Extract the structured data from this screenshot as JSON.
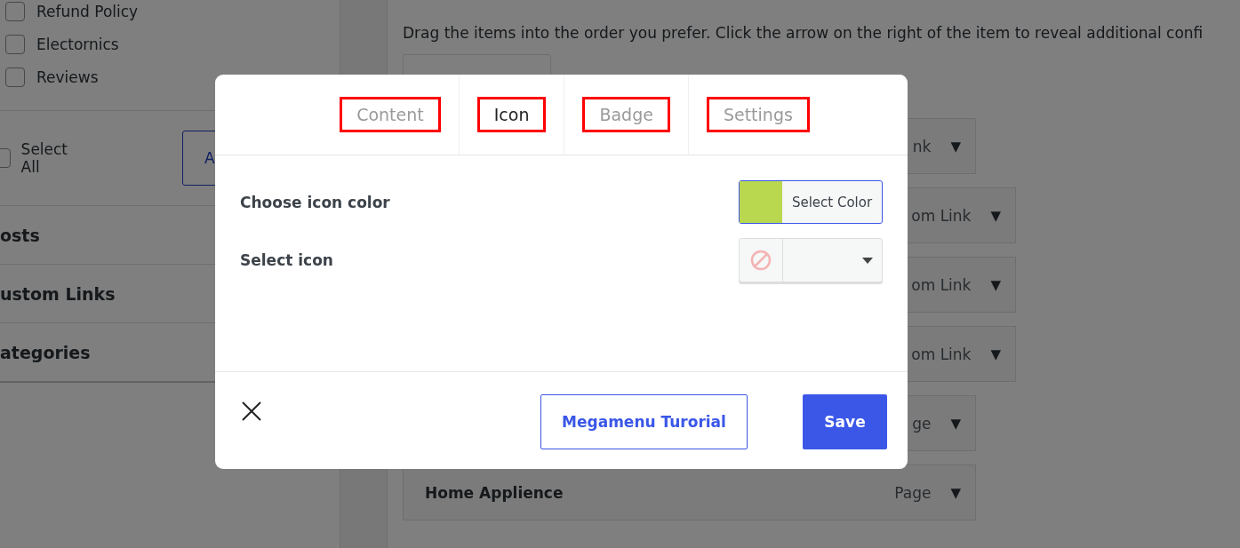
{
  "sidebar": {
    "checkboxes": [
      {
        "label": "Refund Policy",
        "checked": false
      },
      {
        "label": "Electornics",
        "checked": false
      },
      {
        "label": "Reviews",
        "checked": false
      }
    ],
    "select_all": {
      "label": "Select All",
      "checked": false
    },
    "add_button": "A",
    "sections": [
      "osts",
      "ustom Links",
      "ategories"
    ]
  },
  "menu": {
    "instructions": "Drag the items into the order you prefer. Click the arrow on the right of the item to reveal additional confi",
    "items": [
      {
        "type": "nk",
        "arrow": "▼",
        "children": [
          {
            "type": "om Link",
            "arrow": "▼"
          },
          {
            "type": "om Link",
            "arrow": "▼"
          },
          {
            "type": "om Link",
            "arrow": "▼"
          }
        ]
      },
      {
        "type": "ge",
        "arrow": "▼"
      },
      {
        "label": "Home Applience",
        "type": "Page",
        "arrow": "▼"
      }
    ]
  },
  "modal": {
    "tabs": [
      {
        "label": "Content",
        "selected": false,
        "outlined": true
      },
      {
        "label": "Icon",
        "selected": true,
        "outlined": true
      },
      {
        "label": "Badge",
        "selected": false,
        "outlined": true
      },
      {
        "label": "Settings",
        "selected": false,
        "outlined": true
      }
    ],
    "fields": [
      {
        "kind": "color",
        "label": "Choose icon color",
        "button": "Select Color",
        "color": "#b9d850"
      },
      {
        "kind": "icon_select",
        "label": "Select icon"
      }
    ],
    "buttons": [
      {
        "kind": "outline",
        "label": "Megamenu Turorial"
      },
      {
        "kind": "primary",
        "label": "Save"
      }
    ]
  }
}
